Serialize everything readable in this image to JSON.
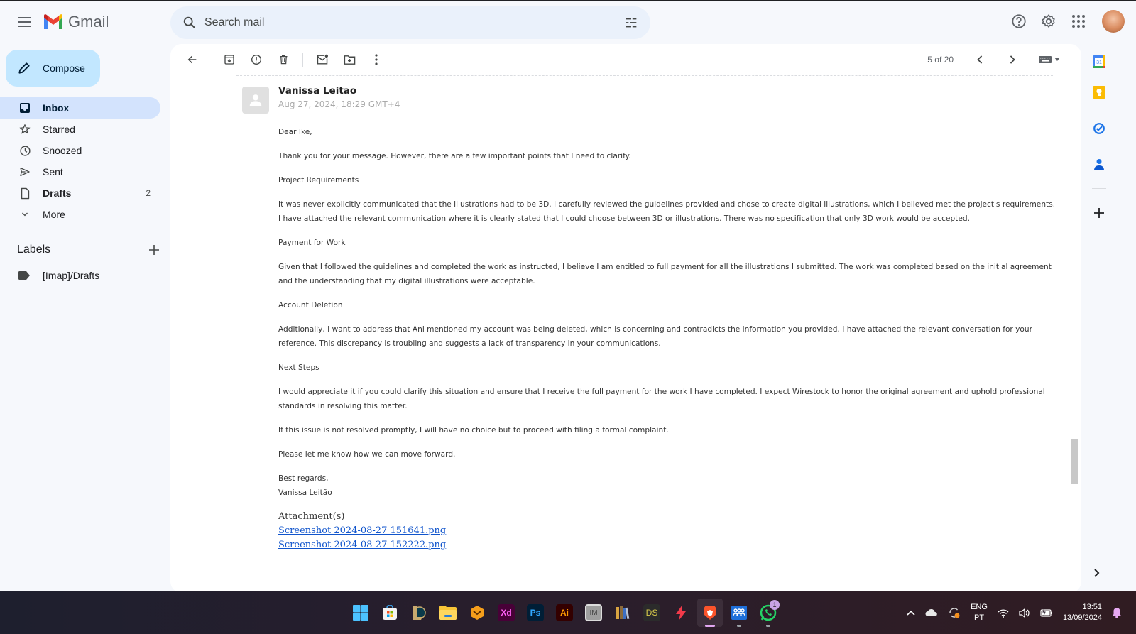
{
  "app": {
    "name": "Gmail",
    "accent": "#c2e7ff",
    "active_nav_bg": "#d3e3fd"
  },
  "search": {
    "placeholder": "Search mail",
    "value": ""
  },
  "header_icons": [
    "help-icon",
    "settings-icon",
    "apps-grid-icon",
    "account-avatar"
  ],
  "compose": {
    "label": "Compose"
  },
  "nav": [
    {
      "label": "Inbox",
      "icon": "inbox-icon",
      "active": true
    },
    {
      "label": "Starred",
      "icon": "star-icon"
    },
    {
      "label": "Snoozed",
      "icon": "clock-icon"
    },
    {
      "label": "Sent",
      "icon": "send-icon"
    },
    {
      "label": "Drafts",
      "icon": "draft-icon",
      "count": "2",
      "bold": true
    },
    {
      "label": "More",
      "icon": "chevron-down-icon"
    }
  ],
  "labels": {
    "title": "Labels",
    "items": [
      {
        "label": "[Imap]/Drafts",
        "icon": "label-icon"
      }
    ]
  },
  "toolbar": {
    "actions": [
      "back",
      "archive",
      "report-spam",
      "delete",
      "mark-unread",
      "move-to",
      "more"
    ],
    "pager": "5 of 20"
  },
  "message": {
    "sender": "Vanissa Leitão",
    "date": "Aug 27, 2024, 18:29 GMT+4",
    "paragraphs": [
      "Dear Ike,",
      "Thank you for your message. However, there are a few important points that I need to clarify.",
      "Project Requirements",
      "It was never explicitly communicated that the illustrations had to be 3D. I carefully reviewed the guidelines provided and chose to create digital illustrations, which I believed met the project's requirements. I have attached the relevant communication where it is clearly stated that I could choose between 3D or illustrations. There was no specification that only 3D work would be accepted.",
      "Payment for Work",
      "Given that I followed the guidelines and completed the work as instructed, I believe I am entitled to full payment for all the illustrations I submitted. The work was completed based on the initial agreement and the understanding that my digital illustrations were acceptable.",
      "Account Deletion",
      "Additionally, I want to address that Ani mentioned my account was being deleted, which is concerning and contradicts the information you provided. I have attached the relevant conversation for your reference. This discrepancy is troubling and suggests a lack of transparency in your communications.",
      "Next Steps",
      "I would appreciate it if you could clarify this situation and ensure that I receive the full payment for the work I have completed. I expect Wirestock to honor the original agreement and uphold professional standards in resolving this matter.",
      "If this issue is not resolved promptly, I will have no choice but to proceed with filing a formal complaint.",
      "Please let me know how we can move forward."
    ],
    "closing": "Best regards,",
    "signature": "Vanissa Leitão",
    "attachments_title": "Attachment(s)",
    "attachments": [
      "Screenshot 2024-08-27 151641.png",
      "Screenshot 2024-08-27 152222.png"
    ]
  },
  "right_rail": [
    "calendar-icon",
    "keep-icon",
    "tasks-icon",
    "contacts-icon",
    "add-addon-icon"
  ],
  "taskbar": {
    "apps": [
      {
        "name": "start",
        "label": ""
      },
      {
        "name": "microsoft-store",
        "label": ""
      },
      {
        "name": "league-of-legends",
        "label": ""
      },
      {
        "name": "file-explorer",
        "label": ""
      },
      {
        "name": "app-orange",
        "label": ""
      },
      {
        "name": "adobe-xd",
        "label": "Xd"
      },
      {
        "name": "photoshop",
        "label": "Ps"
      },
      {
        "name": "illustrator",
        "label": "Ai"
      },
      {
        "name": "app-im",
        "label": "IM"
      },
      {
        "name": "library",
        "label": ""
      },
      {
        "name": "app-ds",
        "label": "DS"
      },
      {
        "name": "app-bolt",
        "label": ""
      },
      {
        "name": "brave-browser",
        "label": "",
        "active": true
      },
      {
        "name": "app-people",
        "label": ""
      },
      {
        "name": "whatsapp",
        "label": "",
        "badge": "1"
      }
    ],
    "tray": {
      "lang_top": "ENG",
      "lang_bottom": "PT",
      "time": "13:51",
      "date": "13/09/2024"
    }
  }
}
